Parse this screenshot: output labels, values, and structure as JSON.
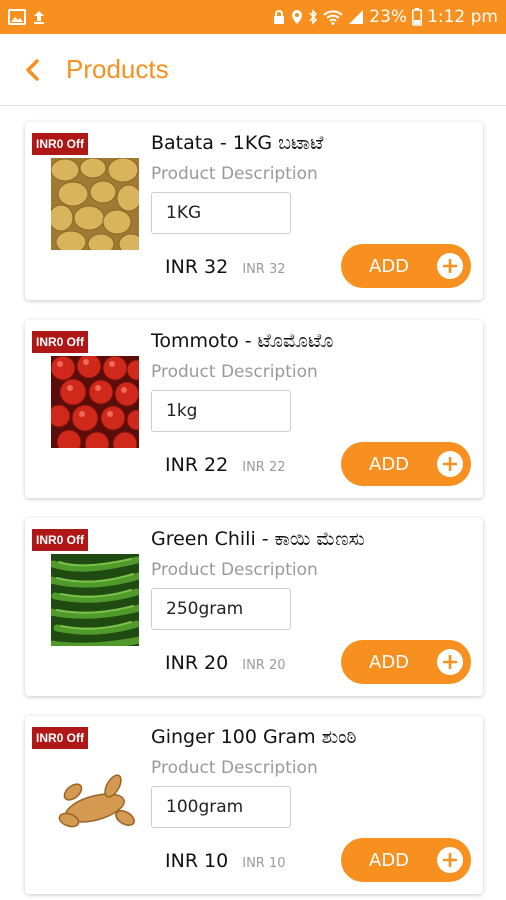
{
  "status_bar": {
    "battery": "23%",
    "time": "1:12 pm",
    "icons": [
      "image-icon",
      "upload-icon",
      "lock-icon",
      "location-icon",
      "bluetooth-icon",
      "wifi-icon",
      "signal-icon",
      "battery-icon"
    ]
  },
  "header": {
    "title": "Products",
    "back_icon": "chevron-left-icon"
  },
  "colors": {
    "accent": "#f7901e",
    "badge": "#b01818"
  },
  "products": [
    {
      "badge": "INR0 Off",
      "name": "Batata - 1KG ಬಟಾಟೆ",
      "description": "Product Description",
      "quantity": "1KG",
      "price": "INR 32",
      "mrp": "INR 32",
      "add_label": "ADD"
    },
    {
      "badge": "INR0 Off",
      "name": "Tommoto -  ಟೊಮೊಟೊ",
      "description": "Product Description",
      "quantity": "1kg",
      "price": "INR 22",
      "mrp": "INR 22",
      "add_label": "ADD"
    },
    {
      "badge": "INR0 Off",
      "name": "Green Chili - ಕಾಯಿ ಮೆಣಸು",
      "description": "Product Description",
      "quantity": "250gram",
      "price": "INR 20",
      "mrp": "INR 20",
      "add_label": "ADD"
    },
    {
      "badge": "INR0 Off",
      "name": "Ginger 100 Gram ಶುಂಠಿ",
      "description": "Product Description",
      "quantity": "100gram",
      "price": "INR 10",
      "mrp": "INR 10",
      "add_label": "ADD"
    }
  ]
}
